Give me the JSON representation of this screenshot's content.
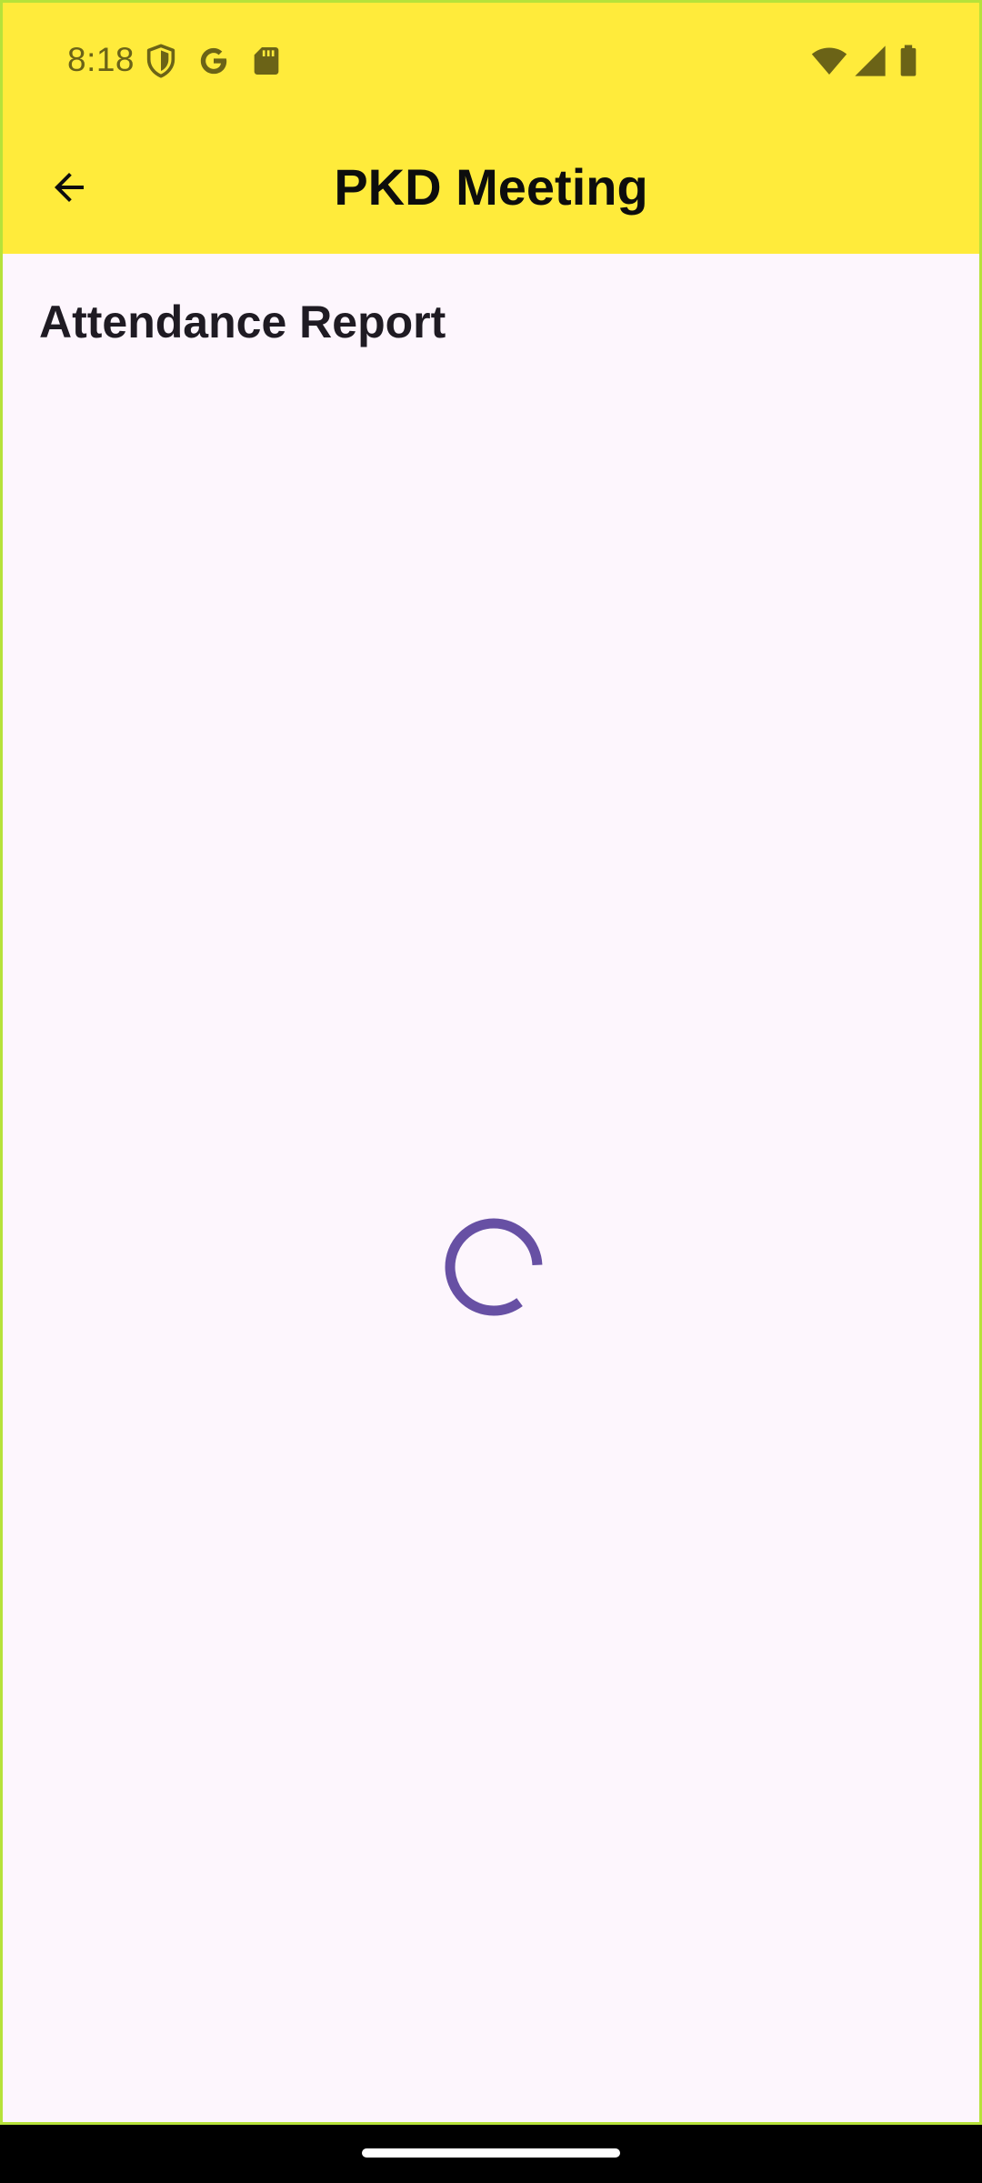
{
  "status_bar": {
    "time": "8:18",
    "left_icons": [
      "shield-icon",
      "google-icon",
      "sd-card-icon"
    ],
    "right_icons": [
      "wifi-icon",
      "cell-signal-icon",
      "battery-icon"
    ]
  },
  "app_bar": {
    "title": "PKD Meeting",
    "back_icon": "arrow-back-icon",
    "background_color": "#ffeb3b"
  },
  "content": {
    "section_title": "Attendance Report",
    "loading_indicator_color": "#6750a4",
    "background_color": "#fdf6fd"
  }
}
